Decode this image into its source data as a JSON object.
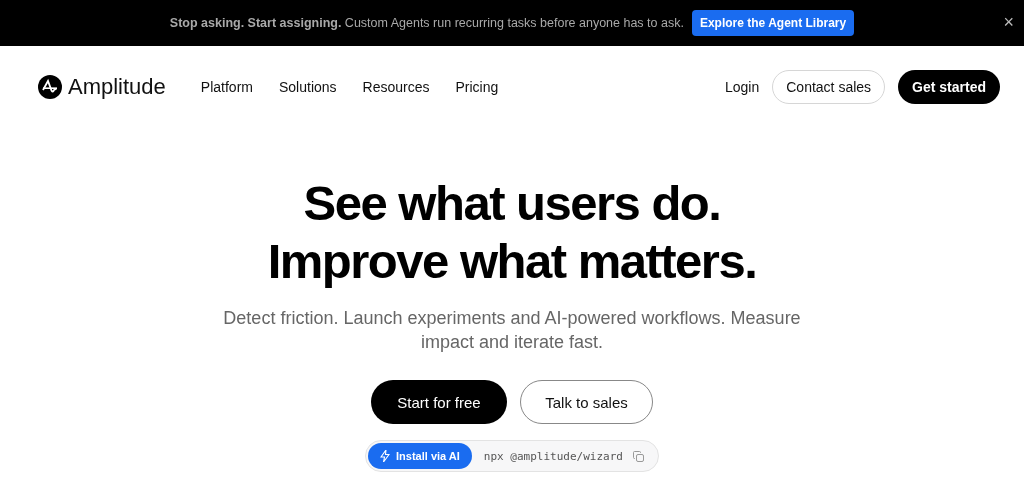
{
  "banner": {
    "text": "**Stop asking. Start assigning.** Custom Agents run recurring tasks before anyone has to ask.",
    "button": "Explore the Agent Library",
    "close": "×"
  },
  "nav": {
    "logo": "Amplitude",
    "links": [
      "Platform",
      "Solutions",
      "Resources",
      "Pricing"
    ],
    "login": "Login",
    "contact": "Contact sales",
    "cta": "Get started"
  },
  "hero": {
    "title_lines": [
      "See what users do.",
      "Improve what matters."
    ],
    "subtitle": "Detect friction. Launch experiments and AI-powered workflows. Measure impact and iterate fast.",
    "primary": "Start for free",
    "secondary": "Talk to sales",
    "install": {
      "button": "Install via AI",
      "command": "npx @amplitude/wizard"
    }
  }
}
